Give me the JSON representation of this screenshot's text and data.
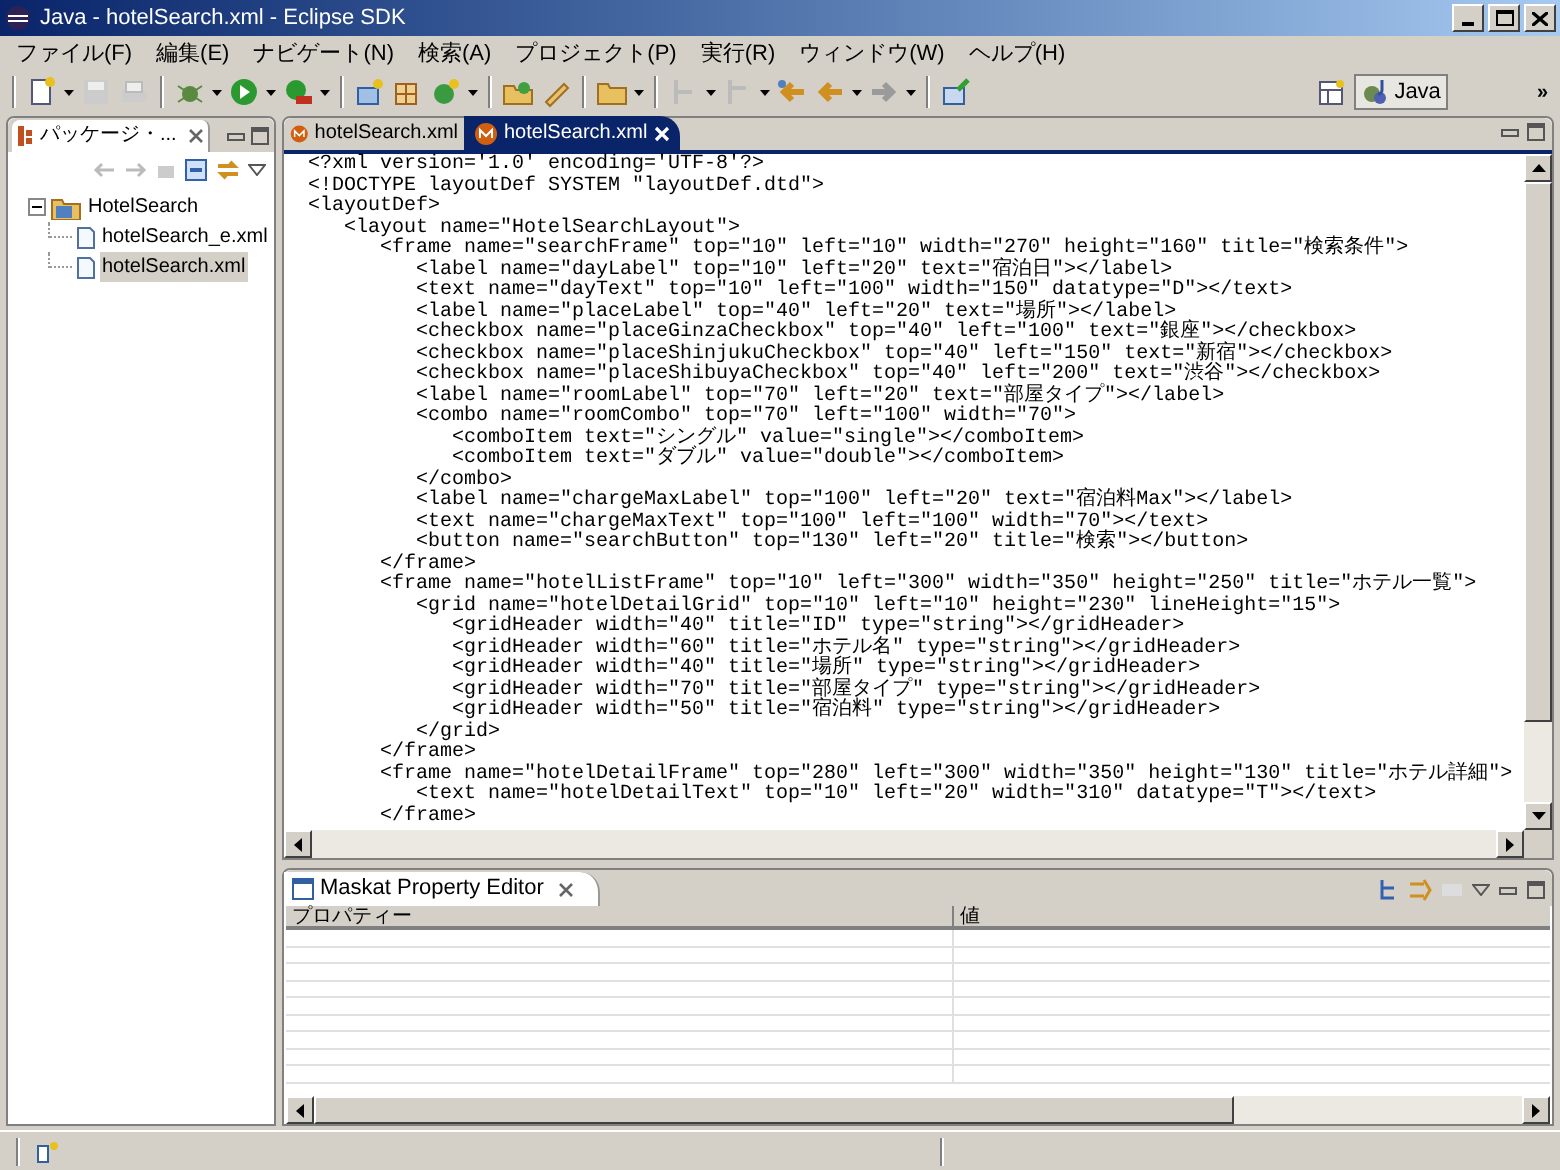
{
  "window": {
    "title": "Java - hotelSearch.xml - Eclipse SDK"
  },
  "menu": [
    "ファイル(F)",
    "編集(E)",
    "ナビゲート(N)",
    "検索(A)",
    "プロジェクト(P)",
    "実行(R)",
    "ウィンドウ(W)",
    "ヘルプ(H)"
  ],
  "perspective": {
    "label": "Java",
    "selected": true
  },
  "overflow": "»",
  "package_explorer": {
    "title": "パッケージ・...",
    "tree": [
      {
        "label": "HotelSearch",
        "expanded": true,
        "selected": false,
        "children": [
          {
            "label": "hotelSearch_e.xml",
            "selected": false
          },
          {
            "label": "hotelSearch.xml",
            "selected": true
          }
        ]
      }
    ]
  },
  "editor": {
    "tabs": [
      {
        "label": "hotelSearch.xml",
        "selected": false
      },
      {
        "label": "hotelSearch.xml",
        "selected": true
      }
    ],
    "lines": [
      "<?xml version='1.0' encoding='UTF-8'?>",
      "<!DOCTYPE layoutDef SYSTEM \"layoutDef.dtd\">",
      "<layoutDef>",
      "   <layout name=\"HotelSearchLayout\">",
      "      <frame name=\"searchFrame\" top=\"10\" left=\"10\" width=\"270\" height=\"160\" title=\"検索条件\">",
      "         <label name=\"dayLabel\" top=\"10\" left=\"20\" text=\"宿泊日\"></label>",
      "         <text name=\"dayText\" top=\"10\" left=\"100\" width=\"150\" datatype=\"D\"></text>",
      "         <label name=\"placeLabel\" top=\"40\" left=\"20\" text=\"場所\"></label>",
      "         <checkbox name=\"placeGinzaCheckbox\" top=\"40\" left=\"100\" text=\"銀座\"></checkbox>",
      "         <checkbox name=\"placeShinjukuCheckbox\" top=\"40\" left=\"150\" text=\"新宿\"></checkbox>",
      "         <checkbox name=\"placeShibuyaCheckbox\" top=\"40\" left=\"200\" text=\"渋谷\"></checkbox>",
      "         <label name=\"roomLabel\" top=\"70\" left=\"20\" text=\"部屋タイプ\"></label>",
      "         <combo name=\"roomCombo\" top=\"70\" left=\"100\" width=\"70\">",
      "            <comboItem text=\"シングル\" value=\"single\"></comboItem>",
      "            <comboItem text=\"ダブル\" value=\"double\"></comboItem>",
      "         </combo>",
      "         <label name=\"chargeMaxLabel\" top=\"100\" left=\"20\" text=\"宿泊料Max\"></label>",
      "         <text name=\"chargeMaxText\" top=\"100\" left=\"100\" width=\"70\"></text>",
      "         <button name=\"searchButton\" top=\"130\" left=\"20\" title=\"検索\"></button>",
      "      </frame>",
      "      <frame name=\"hotelListFrame\" top=\"10\" left=\"300\" width=\"350\" height=\"250\" title=\"ホテル一覧\">",
      "         <grid name=\"hotelDetailGrid\" top=\"10\" left=\"10\" height=\"230\" lineHeight=\"15\">",
      "            <gridHeader width=\"40\" title=\"ID\" type=\"string\"></gridHeader>",
      "            <gridHeader width=\"60\" title=\"ホテル名\" type=\"string\"></gridHeader>",
      "            <gridHeader width=\"40\" title=\"場所\" type=\"string\"></gridHeader>",
      "            <gridHeader width=\"70\" title=\"部屋タイプ\" type=\"string\"></gridHeader>",
      "            <gridHeader width=\"50\" title=\"宿泊料\" type=\"string\"></gridHeader>",
      "         </grid>",
      "      </frame>",
      "      <frame name=\"hotelDetailFrame\" top=\"280\" left=\"300\" width=\"350\" height=\"130\" title=\"ホテル詳細\">",
      "         <text name=\"hotelDetailText\" top=\"10\" left=\"20\" width=\"310\" datatype=\"T\"></text>",
      "      </frame>"
    ]
  },
  "property_editor": {
    "title": "Maskat Property Editor",
    "columns": [
      "プロパティー",
      "値"
    ]
  }
}
